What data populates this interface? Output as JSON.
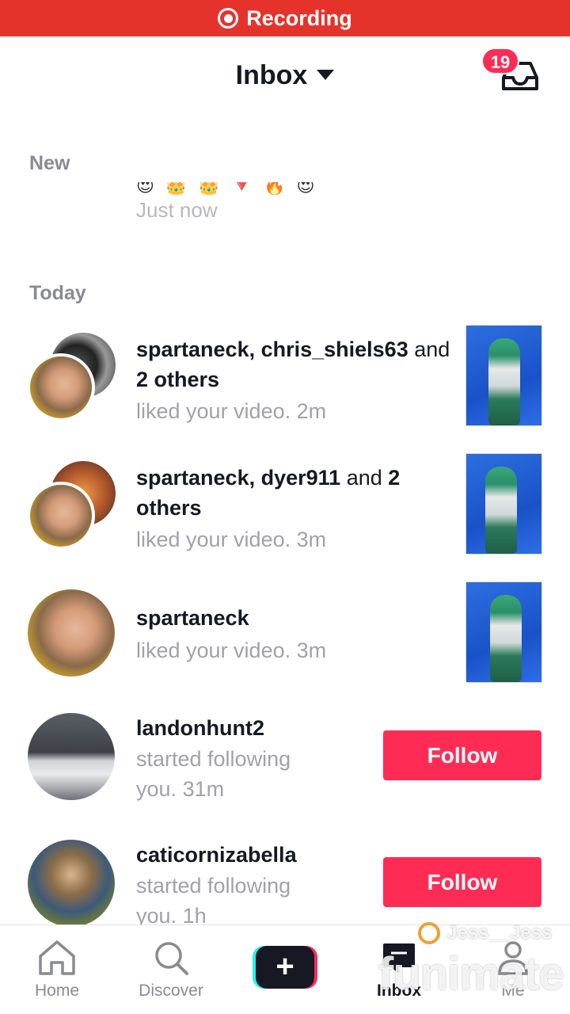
{
  "status_bar": {
    "recording_label": "Recording",
    "color": "#e5332b"
  },
  "header": {
    "title": "Inbox",
    "badge_count": "19"
  },
  "sections": {
    "new_label": "New",
    "today_label": "Today"
  },
  "new_item": {
    "emoji_reactions": "😍👑👑🔻🔥😍",
    "time": "Just now"
  },
  "notifications": [
    {
      "users": "spartaneck, chris_shiels63",
      "and": " and ",
      "others": "2 others",
      "action": "liked your video.",
      "time": "2m"
    },
    {
      "users": "spartaneck, dyer911",
      "and": " and ",
      "others": "2 others",
      "action": "liked your video.",
      "time": "3m"
    },
    {
      "users": "spartaneck",
      "action": "liked your video.",
      "time": "3m"
    },
    {
      "users": "landonhunt2",
      "action_line1": "started following",
      "action_line2": "you.",
      "time": "31m",
      "button": "Follow"
    },
    {
      "users": "caticornizabella",
      "action_line1": "started following",
      "action_line2": "you.",
      "time": "1h",
      "button": "Follow"
    }
  ],
  "tabbar": {
    "home": "Home",
    "discover": "Discover",
    "create": "+",
    "inbox": "Inbox",
    "me": "Me"
  },
  "watermark": {
    "user": "Jess__Jess",
    "brand": "funimate"
  },
  "colors": {
    "accent": "#fe2c55",
    "text": "#161823",
    "muted": "#a1a2a7"
  }
}
